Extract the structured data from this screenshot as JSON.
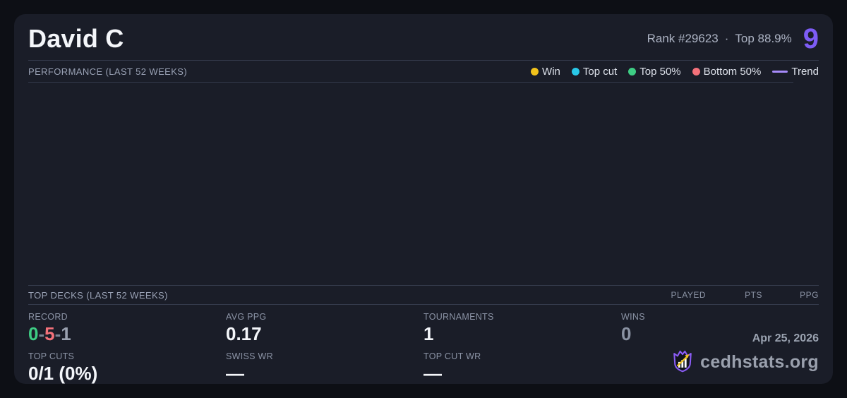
{
  "colors": {
    "accent_purple": "#7d5cf5",
    "trend_purple": "#a78bfa",
    "win_yellow": "#f1c21b",
    "top_cut_cyan": "#29c8e8",
    "top50_green": "#3ecd84",
    "bottom50_red": "#f4717a",
    "draw_grey": "#9aa1b0",
    "muted_value_grey": "#8a92a2"
  },
  "header": {
    "player_name": "David C",
    "rank": "Rank #29623",
    "separator": "·",
    "top_percent": "Top 88.9%",
    "score": "9"
  },
  "performance": {
    "title": "PERFORMANCE (LAST 52 WEEKS)",
    "legend": [
      {
        "label": "Win",
        "color": "#f1c21b",
        "swatch": "dot"
      },
      {
        "label": "Top cut",
        "color": "#29c8e8",
        "swatch": "dot"
      },
      {
        "label": "Top 50%",
        "color": "#3ecd84",
        "swatch": "dot"
      },
      {
        "label": "Bottom 50%",
        "color": "#f4717a",
        "swatch": "dot"
      },
      {
        "label": "Trend",
        "color": "#a78bfa",
        "swatch": "line"
      }
    ],
    "chart_points": []
  },
  "top_decks": {
    "title": "TOP DECKS (LAST 52 WEEKS)",
    "columns": [
      "PLAYED",
      "PTS",
      "PPG"
    ],
    "rows": []
  },
  "stats": {
    "record": {
      "label": "RECORD",
      "wins": "0",
      "losses": "5",
      "draws": "1",
      "separator": "-"
    },
    "top_cuts": {
      "label": "TOP CUTS",
      "value": "0/1 (0%)"
    },
    "avg_ppg": {
      "label": "AVG PPG",
      "value": "0.17"
    },
    "swiss_wr": {
      "label": "SWISS WR",
      "value": "—"
    },
    "tournaments": {
      "label": "TOURNAMENTS",
      "value": "1"
    },
    "top_cut_wr": {
      "label": "TOP CUT WR",
      "value": "—"
    },
    "wins": {
      "label": "WINS",
      "value": "0"
    }
  },
  "footer": {
    "date": "Apr 25, 2026",
    "site": "cedhstats.org",
    "logo": "cedhstats-shield-logo"
  }
}
